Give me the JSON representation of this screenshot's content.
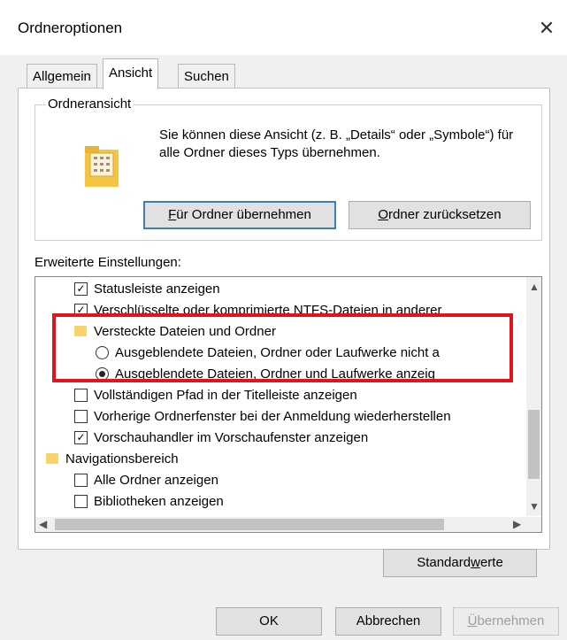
{
  "window": {
    "title": "Ordneroptionen",
    "close_glyph": "✕"
  },
  "tabs": [
    {
      "label": "Allgemein",
      "active": false
    },
    {
      "label": "Ansicht",
      "active": true
    },
    {
      "label": "Suchen",
      "active": false
    }
  ],
  "folder_views": {
    "label": "Ordneransicht",
    "description": "Sie können diese Ansicht (z. B. „Details“ oder „Symbole“) für alle Ordner dieses Typs übernehmen.",
    "apply_button": {
      "prefix": "",
      "accel": "F",
      "rest": "ür Ordner übernehmen"
    },
    "reset_button": {
      "prefix": "",
      "accel": "O",
      "rest": "rdner zurücksetzen"
    }
  },
  "advanced": {
    "label": "Erweiterte Einstellungen:",
    "items": [
      {
        "kind": "checkbox",
        "checked": true,
        "label": "Statusleiste anzeigen"
      },
      {
        "kind": "checkbox",
        "checked": true,
        "label": "Verschlüsselte oder komprimierte NTFS-Dateien in anderer"
      },
      {
        "kind": "folder",
        "label": "Versteckte Dateien und Ordner"
      },
      {
        "kind": "radio",
        "checked": false,
        "label": "Ausgeblendete Dateien, Ordner oder Laufwerke nicht a"
      },
      {
        "kind": "radio",
        "checked": true,
        "label": "Ausgeblendete Dateien, Ordner und Laufwerke anzeig"
      },
      {
        "kind": "checkbox",
        "checked": false,
        "label": "Vollständigen Pfad in der Titelleiste anzeigen"
      },
      {
        "kind": "checkbox",
        "checked": false,
        "label": "Vorherige Ordnerfenster bei der Anmeldung wiederherstellen"
      },
      {
        "kind": "checkbox",
        "checked": true,
        "label": "Vorschauhandler im Vorschaufenster anzeigen"
      },
      {
        "kind": "folder",
        "label": "Navigationsbereich"
      },
      {
        "kind": "checkbox",
        "checked": false,
        "label": "Alle Ordner anzeigen"
      },
      {
        "kind": "checkbox",
        "checked": false,
        "label": "Bibliotheken anzeigen"
      }
    ]
  },
  "defaults_button": {
    "prefix": "Standard",
    "accel": "w",
    "rest": "erte"
  },
  "footer": {
    "ok": "OK",
    "cancel": "Abbrechen",
    "apply": {
      "prefix": "",
      "accel": "Ü",
      "rest": "bernehmen"
    }
  },
  "colors": {
    "highlight": "#e1141d",
    "focus_border": "#3c7fb1",
    "folder": "#f7d46a"
  }
}
